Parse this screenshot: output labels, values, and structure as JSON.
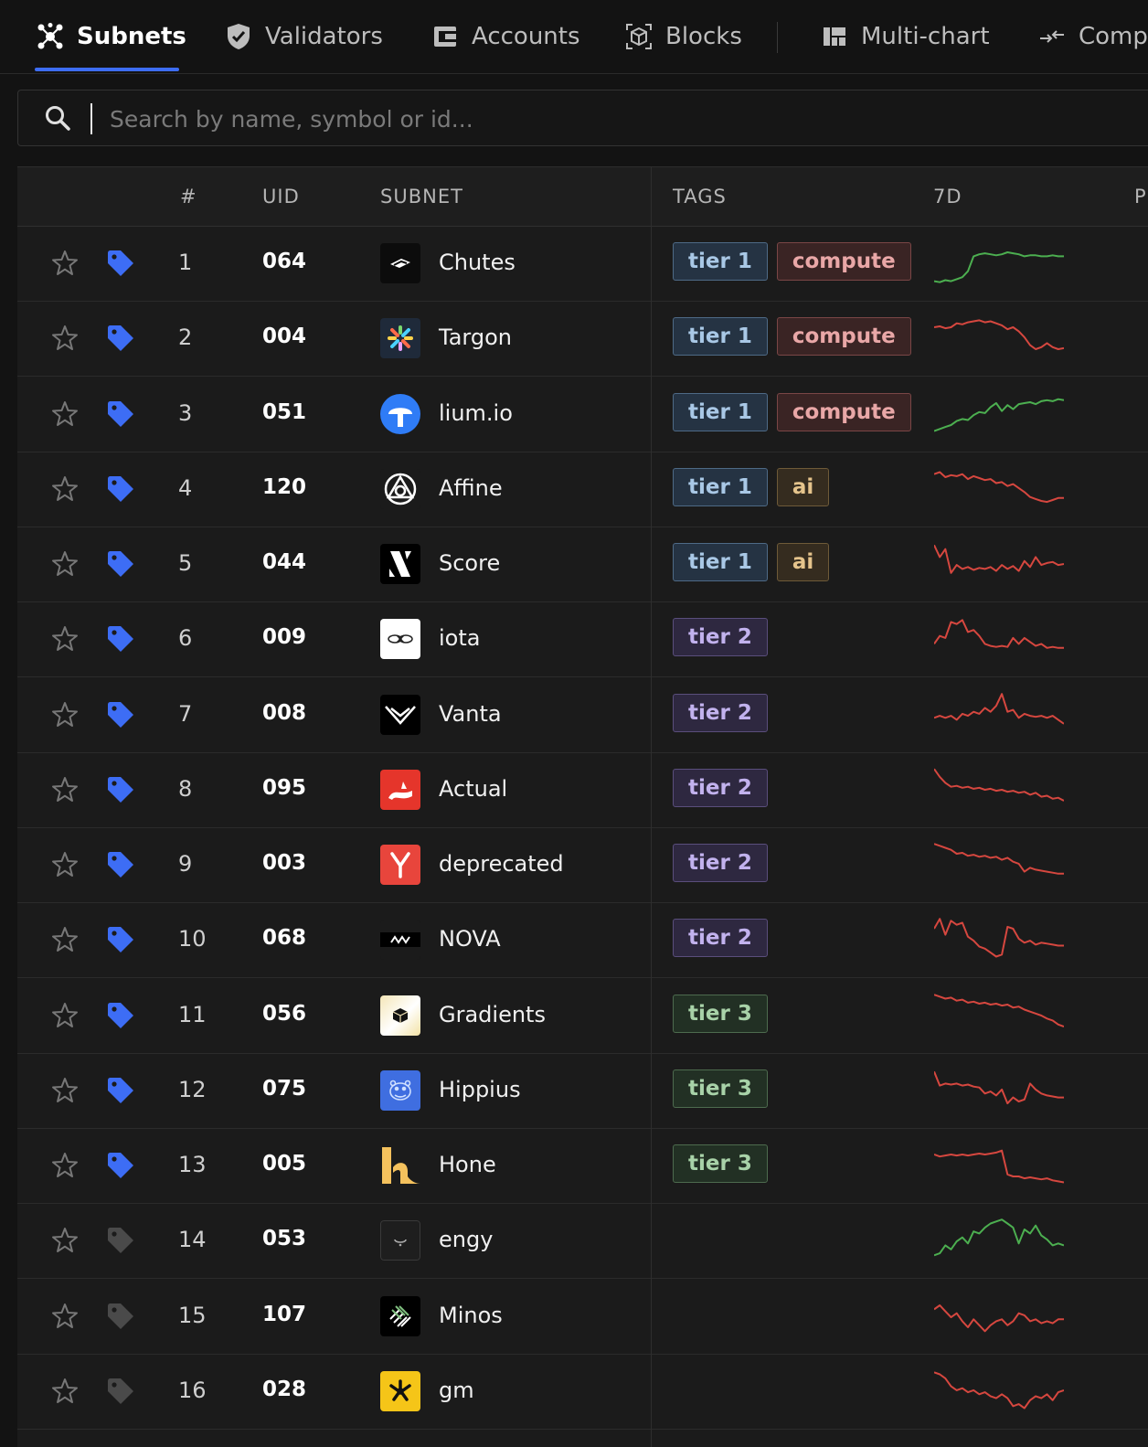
{
  "nav": {
    "tabs": [
      {
        "label": "Subnets",
        "icon": "network-icon",
        "active": true
      },
      {
        "label": "Validators",
        "icon": "shield-icon"
      },
      {
        "label": "Accounts",
        "icon": "wallet-icon"
      },
      {
        "label": "Blocks",
        "icon": "cube-icon"
      },
      {
        "label": "Multi-chart",
        "icon": "grid-chart-icon"
      },
      {
        "label": "Comp",
        "icon": "compare-arrows-icon"
      }
    ]
  },
  "search": {
    "placeholder": "Search by name, symbol or id..."
  },
  "table": {
    "headers": {
      "rank": "#",
      "uid": "UID",
      "subnet": "SUBNET",
      "tags": "TAGS",
      "week": "7D",
      "next": "P"
    },
    "rows": [
      {
        "rank": "1",
        "uid": "064",
        "name": "Chutes",
        "tags": [
          {
            "label": "tier 1",
            "kind": "t1"
          },
          {
            "label": "compute",
            "kind": "compute"
          }
        ],
        "tagged": true,
        "trend": "up",
        "spark": [
          5,
          4,
          6,
          5,
          7,
          9,
          15,
          30,
          32,
          33,
          32,
          31,
          32,
          34,
          33,
          32,
          30,
          31,
          31,
          30,
          30,
          31,
          30,
          30
        ],
        "logo": "chutes"
      },
      {
        "rank": "2",
        "uid": "004",
        "name": "Targon",
        "tags": [
          {
            "label": "tier 1",
            "kind": "t1"
          },
          {
            "label": "compute",
            "kind": "compute"
          }
        ],
        "tagged": true,
        "trend": "down",
        "spark": [
          34,
          35,
          33,
          34,
          38,
          37,
          39,
          40,
          41,
          39,
          40,
          38,
          36,
          32,
          34,
          30,
          24,
          16,
          12,
          14,
          18,
          14,
          12,
          13
        ],
        "logo": "targon"
      },
      {
        "rank": "3",
        "uid": "051",
        "name": "lium.io",
        "tags": [
          {
            "label": "tier 1",
            "kind": "t1"
          },
          {
            "label": "compute",
            "kind": "compute"
          }
        ],
        "tagged": true,
        "trend": "up",
        "spark": [
          6,
          8,
          10,
          12,
          16,
          18,
          17,
          22,
          25,
          24,
          30,
          34,
          26,
          32,
          28,
          33,
          34,
          35,
          33,
          36,
          37,
          36,
          38,
          37
        ],
        "logo": "lium"
      },
      {
        "rank": "4",
        "uid": "120",
        "name": "Affine",
        "tags": [
          {
            "label": "tier 1",
            "kind": "t1"
          },
          {
            "label": "ai",
            "kind": "ai"
          }
        ],
        "tagged": true,
        "trend": "down",
        "spark": [
          38,
          40,
          35,
          37,
          36,
          38,
          33,
          36,
          34,
          32,
          33,
          29,
          30,
          26,
          28,
          24,
          20,
          15,
          13,
          11,
          10,
          12,
          14,
          14
        ],
        "logo": "affine"
      },
      {
        "rank": "5",
        "uid": "044",
        "name": "Score",
        "tags": [
          {
            "label": "tier 1",
            "kind": "t1"
          },
          {
            "label": "ai",
            "kind": "ai"
          }
        ],
        "tagged": true,
        "trend": "down",
        "spark": [
          42,
          30,
          38,
          14,
          22,
          18,
          20,
          17,
          19,
          18,
          20,
          16,
          22,
          18,
          21,
          16,
          26,
          20,
          30,
          22,
          24,
          25,
          22,
          23
        ],
        "logo": "score"
      },
      {
        "rank": "6",
        "uid": "009",
        "name": "iota",
        "tags": [
          {
            "label": "tier 2",
            "kind": "t2"
          }
        ],
        "tagged": true,
        "trend": "down",
        "spark": [
          18,
          26,
          24,
          40,
          38,
          42,
          30,
          32,
          26,
          18,
          16,
          15,
          16,
          15,
          24,
          18,
          24,
          20,
          16,
          18,
          14,
          15,
          14,
          14
        ],
        "logo": "iota"
      },
      {
        "rank": "7",
        "uid": "008",
        "name": "Vanta",
        "tags": [
          {
            "label": "tier 2",
            "kind": "t2"
          }
        ],
        "tagged": true,
        "trend": "down",
        "spark": [
          20,
          22,
          20,
          22,
          18,
          24,
          22,
          26,
          24,
          30,
          26,
          32,
          44,
          26,
          28,
          20,
          24,
          22,
          21,
          22,
          20,
          22,
          18,
          14
        ],
        "logo": "vanta"
      },
      {
        "rank": "8",
        "uid": "095",
        "name": "Actual",
        "tags": [
          {
            "label": "tier 2",
            "kind": "t2"
          }
        ],
        "tagged": true,
        "trend": "down",
        "spark": [
          44,
          36,
          30,
          26,
          27,
          25,
          26,
          24,
          25,
          23,
          24,
          22,
          23,
          21,
          22,
          20,
          21,
          18,
          20,
          16,
          17,
          14,
          15,
          12
        ],
        "logo": "actual"
      },
      {
        "rank": "9",
        "uid": "003",
        "name": "deprecated",
        "tags": [
          {
            "label": "tier 2",
            "kind": "t2"
          }
        ],
        "tagged": true,
        "trend": "down",
        "spark": [
          44,
          42,
          40,
          38,
          34,
          35,
          32,
          33,
          31,
          32,
          30,
          31,
          28,
          30,
          26,
          24,
          16,
          20,
          18,
          17,
          16,
          15,
          14,
          14
        ],
        "logo": "deprecated"
      },
      {
        "rank": "10",
        "uid": "068",
        "name": "NOVA",
        "tags": [
          {
            "label": "tier 2",
            "kind": "t2"
          }
        ],
        "tagged": true,
        "trend": "down",
        "spark": [
          34,
          44,
          28,
          42,
          38,
          40,
          26,
          22,
          16,
          14,
          10,
          6,
          8,
          36,
          34,
          24,
          20,
          22,
          18,
          20,
          19,
          18,
          17,
          17
        ],
        "logo": "nova"
      },
      {
        "rank": "11",
        "uid": "056",
        "name": "Gradients",
        "tags": [
          {
            "label": "tier 3",
            "kind": "t3"
          }
        ],
        "tagged": true,
        "trend": "down",
        "spark": [
          44,
          42,
          40,
          41,
          38,
          39,
          36,
          37,
          35,
          36,
          34,
          35,
          33,
          34,
          31,
          32,
          29,
          27,
          25,
          23,
          20,
          18,
          14,
          12
        ],
        "logo": "gradients"
      },
      {
        "rank": "12",
        "uid": "075",
        "name": "Hippius",
        "tags": [
          {
            "label": "tier 3",
            "kind": "t3"
          }
        ],
        "tagged": true,
        "trend": "down",
        "spark": [
          42,
          28,
          30,
          29,
          30,
          28,
          29,
          27,
          26,
          20,
          22,
          18,
          24,
          10,
          16,
          12,
          14,
          30,
          24,
          20,
          18,
          17,
          16,
          16
        ],
        "logo": "hippius"
      },
      {
        "rank": "13",
        "uid": "005",
        "name": "Hone",
        "tags": [
          {
            "label": "tier 3",
            "kind": "t3"
          }
        ],
        "tagged": true,
        "trend": "down",
        "spark": [
          34,
          32,
          33,
          34,
          33,
          34,
          33,
          34,
          35,
          34,
          35,
          36,
          38,
          14,
          12,
          12,
          10,
          11,
          10,
          9,
          10,
          8,
          7,
          6
        ],
        "logo": "hone"
      },
      {
        "rank": "14",
        "uid": "053",
        "name": "engy",
        "tags": [],
        "tagged": false,
        "trend": "up",
        "spark": [
          8,
          10,
          18,
          14,
          22,
          26,
          20,
          32,
          30,
          36,
          40,
          42,
          44,
          40,
          36,
          20,
          34,
          30,
          38,
          28,
          24,
          18,
          20,
          18
        ],
        "logo": "engy"
      },
      {
        "rank": "15",
        "uid": "107",
        "name": "Minos",
        "tags": [],
        "tagged": false,
        "trend": "down",
        "spark": [
          30,
          34,
          28,
          22,
          26,
          18,
          12,
          20,
          14,
          8,
          14,
          18,
          20,
          14,
          18,
          26,
          24,
          18,
          20,
          16,
          18,
          16,
          20,
          20
        ],
        "logo": "minos"
      },
      {
        "rank": "16",
        "uid": "028",
        "name": "gm",
        "tags": [],
        "tagged": false,
        "trend": "down",
        "spark": [
          42,
          40,
          36,
          28,
          24,
          26,
          22,
          24,
          20,
          22,
          18,
          16,
          20,
          16,
          8,
          10,
          6,
          14,
          18,
          16,
          20,
          14,
          22,
          24
        ],
        "logo": "gm"
      }
    ]
  },
  "colors": {
    "accent": "#3d6df5",
    "up": "#4caf50",
    "down": "#d6473f",
    "tag_blue": "#3d6df5",
    "tag_gray": "#4a4a4a"
  }
}
